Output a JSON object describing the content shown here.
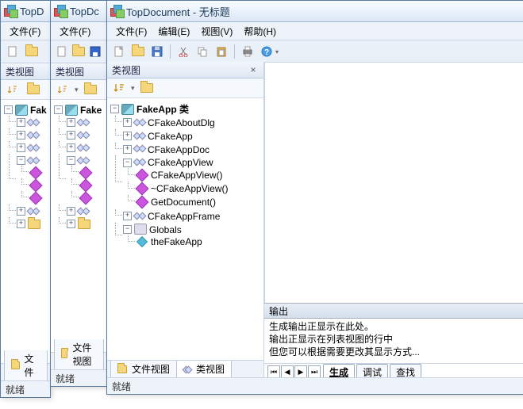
{
  "app": {
    "title": "TopDocument - 无标题",
    "title_short": "TopD"
  },
  "menu": {
    "file": "文件(F)",
    "edit": "编辑(E)",
    "view": "视图(V)",
    "help": "帮助(H)"
  },
  "panes": {
    "classview": "类视图",
    "fileview": "文件视图"
  },
  "tree": {
    "root": "FakeApp 类",
    "n0": "CFakeAboutDlg",
    "n1": "CFakeApp",
    "n2": "CFakeAppDoc",
    "n3": "CFakeAppView",
    "n3_0": "CFakeAppView()",
    "n3_1": "~CFakeAppView()",
    "n3_2": "GetDocument()",
    "n4": "CFakeAppFrame",
    "n5": "Globals",
    "n5_0": "theFakeApp"
  },
  "tabs": {
    "file": "文件视图",
    "class": "类视图"
  },
  "output": {
    "title": "输出",
    "line1": "生成输出正显示在此处。",
    "line2": "输出正显示在列表视图的行中",
    "line3": "但您可以根据需要更改其显示方式...",
    "t_build": "生成",
    "t_debug": "调试",
    "t_find": "查找"
  },
  "status": {
    "ready": "就绪"
  },
  "glyph": {
    "plus": "+",
    "minus": "−",
    "close": "×",
    "first": "⏮",
    "prev": "◀",
    "next": "▶",
    "last": "⏭"
  }
}
